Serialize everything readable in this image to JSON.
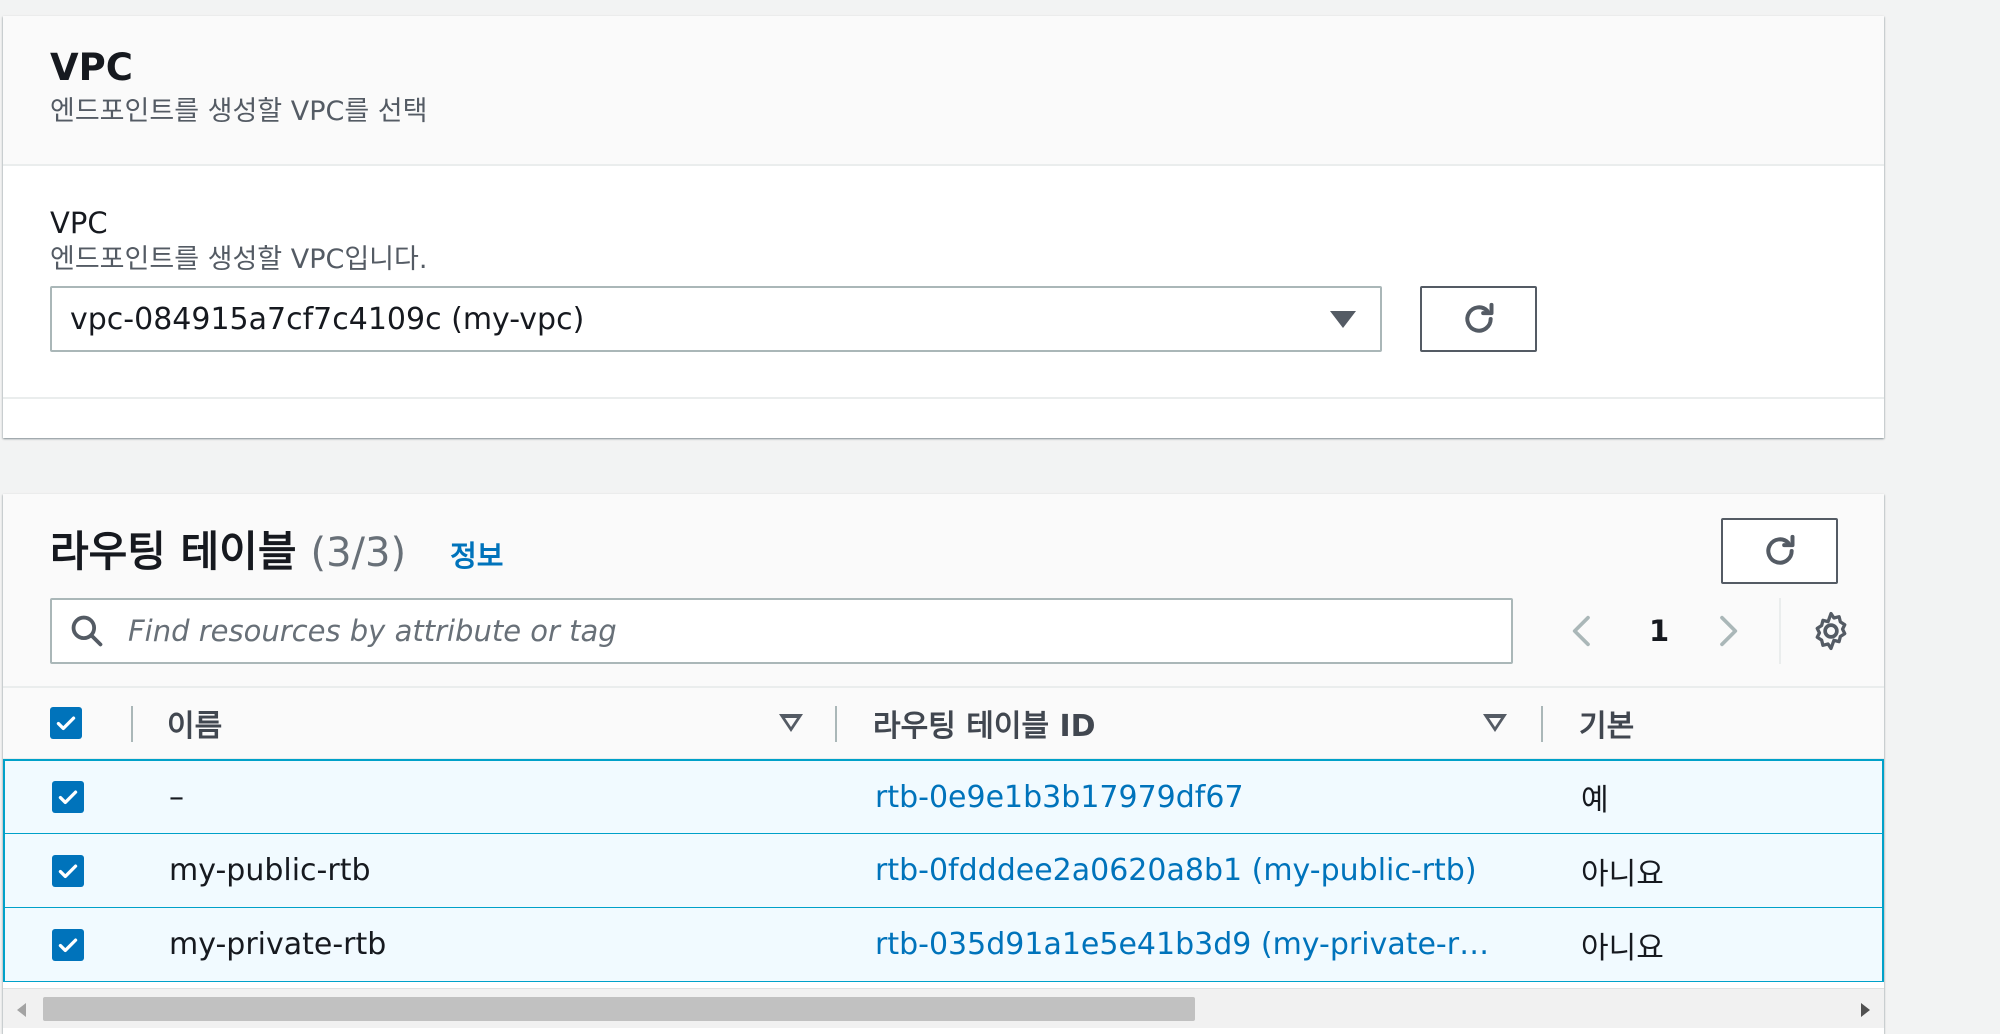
{
  "vpc_section": {
    "title": "VPC",
    "description": "엔드포인트를 생성할 VPC를 선택",
    "field_label": "VPC",
    "field_description": "엔드포인트를 생성할 VPC입니다.",
    "selected_vpc": "vpc-084915a7cf7c4109c (my-vpc)"
  },
  "route_tables": {
    "title": "라우팅 테이블",
    "count": "(3/3)",
    "info_label": "정보",
    "search_placeholder": "Find resources by attribute or tag",
    "current_page": "1",
    "columns": {
      "name": "이름",
      "route_table_id": "라우팅 테이블 ID",
      "main": "기본"
    },
    "rows": [
      {
        "name": "–",
        "route_table_id": "rtb-0e9e1b3b17979df67",
        "main": "예",
        "selected": true
      },
      {
        "name": "my-public-rtb",
        "route_table_id": "rtb-0fdddee2a0620a8b1 (my-public-rtb)",
        "main": "아니요",
        "selected": true
      },
      {
        "name": "my-private-rtb",
        "route_table_id": "rtb-035d91a1e5e41b3d9 (my-private-r…",
        "main": "아니요",
        "selected": true
      }
    ],
    "all_selected": true
  },
  "colors": {
    "accent": "#0073bb",
    "selected_row_bg": "#f1faff",
    "selected_row_border": "#00a1c9"
  },
  "icons": [
    "refresh-icon",
    "search-icon",
    "chevron-left-icon",
    "chevron-right-icon",
    "gear-icon",
    "checkmark-icon",
    "caret-down-icon",
    "sort-caret-icon"
  ]
}
